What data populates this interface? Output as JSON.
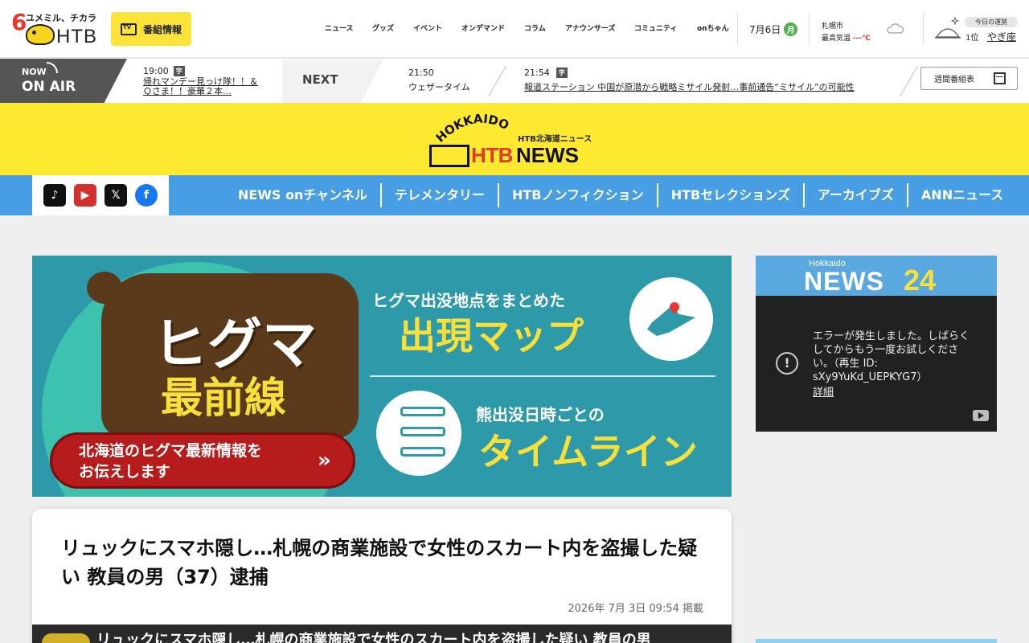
{
  "header": {
    "logo_six": "6",
    "logo_tag": "ユメミル、チカラ",
    "logo_htb": "HTB",
    "program_button": "番組情報",
    "nav": [
      "ニュース",
      "グッズ",
      "イベント",
      "オンデマンド",
      "コラム",
      "アナウンサーズ",
      "コミュニティ",
      "onちゃん"
    ],
    "date": "7月6日",
    "weekday": "月",
    "weather_city": "札幌市",
    "weather_label": "最高気温",
    "weather_temp": "---℃",
    "fortune_title": "今日の運勢",
    "fortune_rank": "1位",
    "fortune_sign": "やぎ座"
  },
  "onair": {
    "now_small": "NOW",
    "now_label": "ON AIR",
    "now_time": "19:00",
    "now_badge": "字",
    "now_title": "帰れマンデー見っけ隊！！＆Ｑさま！！豪華２本…",
    "next_label": "NEXT",
    "next1_time": "21:50",
    "next1_title": "ウェザータイム",
    "next2_time": "21:54",
    "next2_badge": "字",
    "next2_title": "報道ステーション 中国が原潜から戦略ミサイル発射…事前通告“ミサイル”の可能性",
    "weekly_button": "週間番組表"
  },
  "brand": {
    "hokkaido": "HOKKAIDO",
    "sub": "HTB北海道ニュース",
    "htb": "HTB",
    "news": "NEWS"
  },
  "social": {
    "tiktok": "♪",
    "youtube": "▶",
    "x": "𝕏",
    "facebook": "f"
  },
  "category_nav": [
    "NEWS onチャンネル",
    "テレメンタリー",
    "HTBノンフィクション",
    "HTBセレクションズ",
    "アーカイブズ",
    "ANNニュース"
  ],
  "banner": {
    "title": "ヒグマ",
    "subtitle": "最前線",
    "pill": "北海道のヒグマ最新情報を\nお伝えします",
    "pill_arrow": "»",
    "map_head": "ヒグマ出没地点をまとめた",
    "map_big": "出現マップ",
    "tl_head": "熊出没日時ごとの",
    "tl_big": "タイムライン"
  },
  "article": {
    "title": "リュックにスマホ隠し…札幌の商業施設で女性のスカート内を盗撮した疑い 教員の男（37）逮捕",
    "date": "2026年 7月 3日 09:54 掲載",
    "video_caption": "リュックにスマホ隠し…札幌の商業施設で女性のスカート内を盗撮した疑い 教員の男"
  },
  "sidebar": {
    "video_banner_small": "Hokkaido",
    "video_banner_news": "NEWS",
    "video_banner_24": "24",
    "error_icon": "!",
    "error_text": "エラーが発生しました。しばらくしてからもう一度お試しください。（再生 ID: sXy9YuKd_UEPKYG7）",
    "error_detail": "詳細"
  },
  "colors": {
    "brand_yellow": "#fde92f",
    "nav_blue": "#479ee3",
    "banner_teal": "#2e99a9",
    "bear_brown": "#5a3a1b",
    "accent_red": "#e23b2d"
  }
}
